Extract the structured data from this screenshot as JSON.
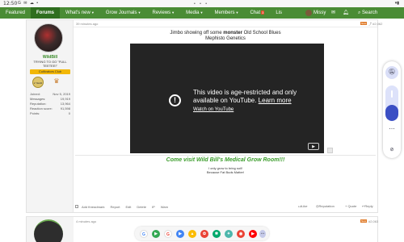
{
  "status_bar": {
    "time": "12:50",
    "icons": "G ✉ ☁ •",
    "notch": "• • •",
    "right": "▾▮"
  },
  "nav": {
    "tabs": [
      "Featured",
      "Forums",
      "What's new",
      "Grow Journals",
      "Reviews",
      "Media",
      "Members",
      "Chat",
      "Lis"
    ],
    "active_tab": "Forums",
    "chat_badge": "3",
    "username": "Missy",
    "search_label": "Search"
  },
  "post": {
    "time": "39 minutes ago",
    "new_badge": "New",
    "number": "#2,062",
    "line1_prefix": "Jimbo showing off some ",
    "line1_bold": "monster",
    "line1_suffix": " Old School Blues",
    "line2": "Mephisto Genetics",
    "video_msg": "This video is age-restricted and only available on YouTube.",
    "video_learn": "Learn more",
    "video_link": "Watch on YouTube",
    "sig_title": "Come visit Wild Bill's Medical Grow Room!!!",
    "sig_line1": "I only grow to bring soil!",
    "sig_line2": "Because Fat Buds Matter!"
  },
  "author": {
    "name": "WildBill",
    "title": "TRYING TO GO \"FULL TEETEE!\"",
    "banner": "Cultivators Club",
    "trophy1": "2 YEAR",
    "stats": [
      {
        "label": "Joined:",
        "value": "Nov 5, 2019"
      },
      {
        "label": "Messages:",
        "value": "19,919"
      },
      {
        "label": "Reputation:",
        "value": "13,964"
      },
      {
        "label": "Reaction score:",
        "value": "91,598"
      },
      {
        "label": "Points:",
        "value": "0"
      }
    ]
  },
  "actions": {
    "threadmark": "Add threadmark",
    "report": "Report",
    "edit": "Edit",
    "delete": "Delete",
    "ip": "IP",
    "warn": "Warn",
    "like": "Like",
    "reputation": "Reputation",
    "quote": "+ Quote",
    "reply": "Reply"
  },
  "next_post": {
    "time": "4 minutes ago",
    "new_badge": "New",
    "number": "#2,063"
  },
  "side_control": {
    "volume_level": 0.45
  },
  "dock": [
    "G",
    "▶",
    "G",
    "▶",
    "▲",
    "✿",
    "✱",
    "✦",
    "◉",
    "▶",
    "⋯"
  ],
  "colors": {
    "forum_green": "#4a8c35",
    "accent_orange": "#e07b29",
    "signature_green": "#3a9c2a"
  }
}
